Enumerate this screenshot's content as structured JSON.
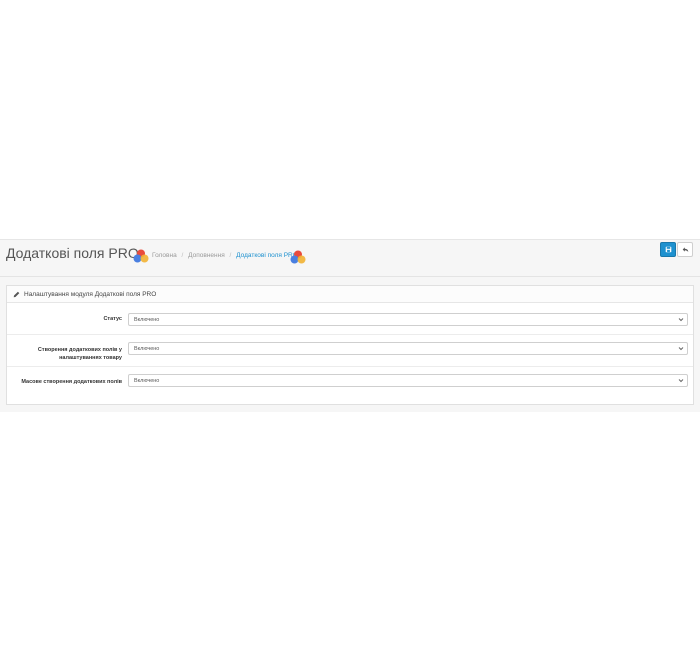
{
  "header": {
    "title": "Додаткові поля PRO",
    "breadcrumb": [
      "Головна",
      "Доповнення",
      "Додаткові поля PRO"
    ]
  },
  "toolbar": {
    "save_icon": "save-icon",
    "back_icon": "reply-icon"
  },
  "panel": {
    "heading": "Налаштування модуля Додаткові поля PRO"
  },
  "form": {
    "fields": [
      {
        "label": "Статус",
        "value": "Включено"
      },
      {
        "label": "Створення додаткових полів у налаштуваннях товару",
        "value": "Включено"
      },
      {
        "label": "Масове створення додаткових полів",
        "value": "Включено"
      }
    ]
  },
  "colors": {
    "accent": "#1e91cf",
    "logo_red": "#e94b3c",
    "logo_blue": "#4a7fe0",
    "logo_yellow": "#f2b233"
  }
}
